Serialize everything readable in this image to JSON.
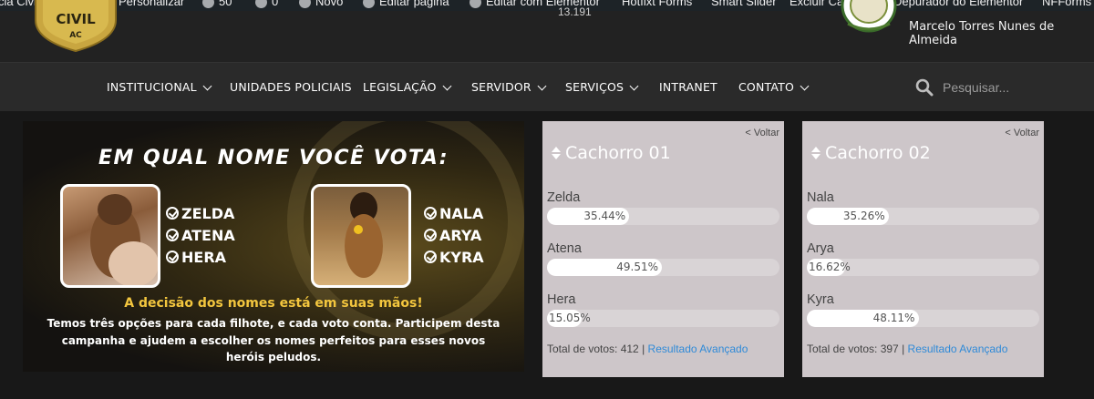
{
  "adminbar": {
    "items": [
      "cia Civil do Acre",
      "Personalizar",
      "50",
      "0",
      "Novo",
      "Editar página",
      "Editar com Elementor",
      "Hotfixt Forms",
      "Smart Slider",
      "Excluir Cache",
      "Depurador do Elementor",
      "NFForms"
    ]
  },
  "header": {
    "date": "13.191",
    "user_name": "Marcelo Torres Nunes de Almeida",
    "logo_text": "CIVIL",
    "logo_sub": "AC"
  },
  "nav": {
    "items": [
      {
        "label": "INSTITUCIONAL",
        "dropdown": true
      },
      {
        "label": "UNIDADES POLICIAIS",
        "dropdown": false
      },
      {
        "label": "LEGISLAÇÃO",
        "dropdown": true
      },
      {
        "label": "SERVIDOR",
        "dropdown": true
      },
      {
        "label": "SERVIÇOS",
        "dropdown": true
      },
      {
        "label": "INTRANET",
        "dropdown": false
      },
      {
        "label": "CONTATO",
        "dropdown": true
      }
    ],
    "search_placeholder": "Pesquisar..."
  },
  "banner": {
    "title": "EM QUAL NOME VOCÊ VOTA:",
    "names_left": [
      "ZELDA",
      "ATENA",
      "HERA"
    ],
    "names_right": [
      "NALA",
      "ARYA",
      "KYRA"
    ],
    "subtitle": "A decisão dos nomes está em suas mãos!",
    "description": "Temos três opções para cada filhote, e cada voto conta. Participem desta campanha e ajudem a escolher os nomes perfeitos para esses novos heróis peludos."
  },
  "polls": [
    {
      "back": "< Voltar",
      "title": "Cachorro 01",
      "options": [
        {
          "label": "Zelda",
          "percent": 35.44,
          "percent_text": "35.44%"
        },
        {
          "label": "Atena",
          "percent": 49.51,
          "percent_text": "49.51%"
        },
        {
          "label": "Hera",
          "percent": 15.05,
          "percent_text": "15.05%"
        }
      ],
      "total_label": "Total de votos: 412",
      "advanced_link": "Resultado Avançado"
    },
    {
      "back": "< Voltar",
      "title": "Cachorro 02",
      "options": [
        {
          "label": "Nala",
          "percent": 35.26,
          "percent_text": "35.26%"
        },
        {
          "label": "Arya",
          "percent": 16.62,
          "percent_text": "16.62%"
        },
        {
          "label": "Kyra",
          "percent": 48.11,
          "percent_text": "48.11%"
        }
      ],
      "total_label": "Total de votos: 397",
      "advanced_link": "Resultado Avançado"
    }
  ],
  "colors": {
    "accent_link": "#2f8ad8",
    "banner_gold": "#f3c63e",
    "poll_bg": "#cdc6c9"
  }
}
